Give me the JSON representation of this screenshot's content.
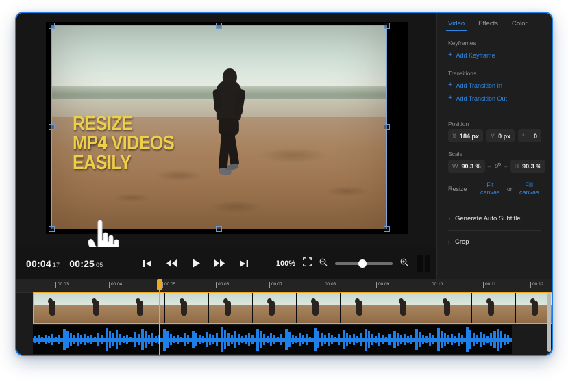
{
  "window": {
    "accent": "#1d7fe8",
    "background": "#1b1b1b"
  },
  "preview": {
    "caption_lines": [
      "RESIZE",
      "MP4 VIDEOS",
      "EASILY"
    ],
    "caption_color": "#edcf4a",
    "scene_description": "person running on beach",
    "cursor_icon": "pointing-hand-cursor"
  },
  "transport": {
    "current_time": "00:04",
    "current_frames": "17",
    "total_time": "00:25",
    "total_frames": "05",
    "buttons": [
      {
        "name": "skip-to-start",
        "icon": "skip-back-icon"
      },
      {
        "name": "rewind",
        "icon": "rewind-icon"
      },
      {
        "name": "play",
        "icon": "play-icon"
      },
      {
        "name": "fast-forward",
        "icon": "fast-forward-icon"
      },
      {
        "name": "skip-to-end",
        "icon": "skip-forward-icon"
      }
    ],
    "zoom_level": "100%",
    "fullscreen_icon": "fullscreen-icon",
    "zoom_out_icon": "zoom-out-icon",
    "zoom_in_icon": "zoom-in-icon"
  },
  "panel": {
    "tabs": [
      {
        "label": "Video",
        "active": true
      },
      {
        "label": "Effects",
        "active": false
      },
      {
        "label": "Color",
        "active": false
      }
    ],
    "keyframes": {
      "label": "Keyframes",
      "add_label": "Add Keyframe"
    },
    "transitions": {
      "label": "Transitions",
      "add_in_label": "Add Transition In",
      "add_out_label": "Add Transition Out"
    },
    "position": {
      "label": "Position",
      "x_key": "X",
      "x_value": "184 px",
      "y_key": "Y",
      "y_value": "0 px",
      "rot_key": "°",
      "rot_value": "0"
    },
    "scale": {
      "label": "Scale",
      "w_key": "W",
      "w_value": "90.3 %",
      "h_key": "H",
      "h_value": "90.3 %",
      "link_icon": "link-icon"
    },
    "resize": {
      "label": "Resize",
      "fit_label": "Fit canvas",
      "or_label": "or",
      "fill_label": "Fill canvas"
    },
    "sections": [
      {
        "label": "Generate Auto Subtitle",
        "icon": "chevron-right-icon"
      },
      {
        "label": "Crop",
        "icon": "chevron-right-icon"
      }
    ]
  },
  "timeline": {
    "ruler_ticks": [
      "00:03",
      "00:04",
      "00:05",
      "00:06",
      "00:07",
      "00:08",
      "00:09",
      "00:10",
      "00:11",
      "00:12"
    ],
    "playhead_time": "00:04",
    "video_track_color": "#f0a81e",
    "audio_waveform_color": "#1d7fe8"
  }
}
